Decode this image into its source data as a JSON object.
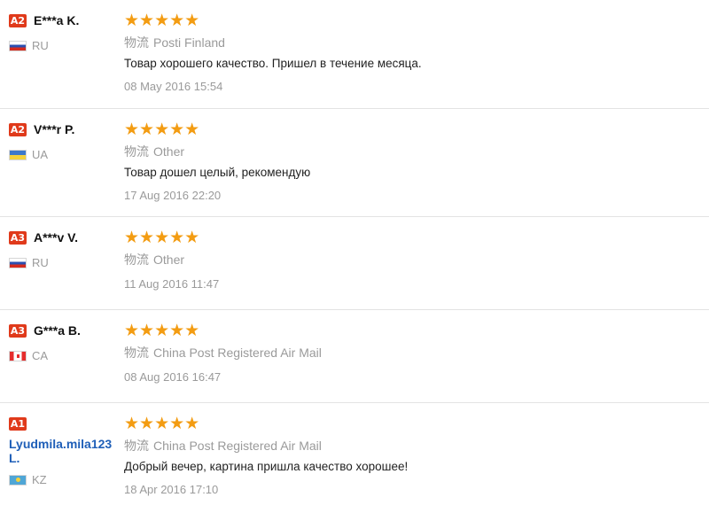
{
  "logistics_label": "物流",
  "star_color": "#f39c12",
  "badge_color": "#e03a1b",
  "reviews": [
    {
      "level": "A2",
      "buyer": "E***a K.",
      "country": "RU",
      "flag": "russia-flag-icon",
      "stars": "★★★★★",
      "shipping": "Posti Finland",
      "comment": "Товар хорошего качество. Пришел в течение месяца.",
      "date": "08 May 2016 15:54"
    },
    {
      "level": "A2",
      "buyer": "V***r P.",
      "country": "UA",
      "flag": "ukraine-flag-icon",
      "stars": "★★★★★",
      "shipping": "Other",
      "comment": "Товар дошел целый, рекомендую",
      "date": "17 Aug 2016 22:20"
    },
    {
      "level": "A3",
      "buyer": "A***v V.",
      "country": "RU",
      "flag": "russia-flag-icon",
      "stars": "★★★★★",
      "shipping": "Other",
      "comment": "",
      "date": "11 Aug 2016 11:47"
    },
    {
      "level": "A3",
      "buyer": "G***a B.",
      "country": "CA",
      "flag": "canada-flag-icon",
      "stars": "★★★★★",
      "shipping": "China Post Registered Air Mail",
      "comment": "",
      "date": "08 Aug 2016 16:47"
    },
    {
      "level": "A1",
      "buyer": "Lyudmila.mila123 L.",
      "country": "KZ",
      "flag": "kazakhstan-flag-icon",
      "stars": "★★★★★",
      "shipping": "China Post Registered Air Mail",
      "comment": "Добрый вечер, картина пришла качество хорошее!",
      "date": "18 Apr 2016 17:10"
    }
  ]
}
